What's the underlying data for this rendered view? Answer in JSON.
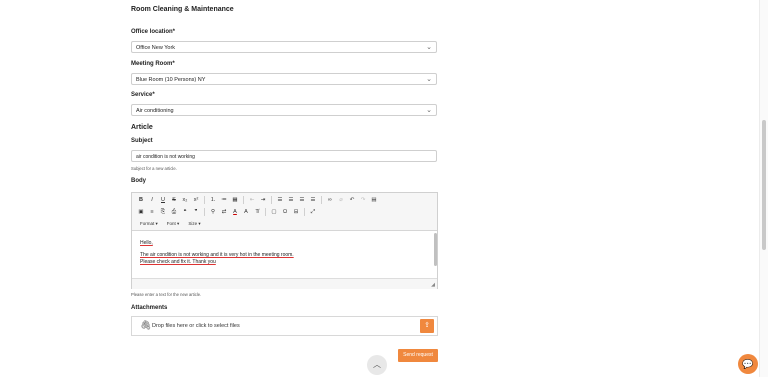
{
  "page": {
    "title": "Room Cleaning & Maintenance"
  },
  "form": {
    "office_location": {
      "label": "Office location*",
      "value": "Office New York"
    },
    "meeting_room": {
      "label": "Meeting Room*",
      "value": "Blue Room (10 Persons) NY"
    },
    "service": {
      "label": "Service*",
      "value": "Air conditioning"
    },
    "article": {
      "section_title": "Article",
      "subject_label": "Subject",
      "subject_value": "air condition is not working",
      "subject_hint": "Subject for a new article.",
      "body_label": "Body",
      "body_hint": "Please enter a text for the new article.",
      "body_lines": [
        "Hello,",
        "The air condition is not working and it is very hot in the meeting room.",
        "Please check and fix it.  Thank you"
      ]
    },
    "editor_toolbar": {
      "format": "Format",
      "font": "Font",
      "size": "Size"
    },
    "attachments": {
      "label": "Attachments",
      "drop_text": "Drop files here or click to select files"
    },
    "submit_label": "Send request"
  },
  "colors": {
    "accent": "#f0883e"
  }
}
